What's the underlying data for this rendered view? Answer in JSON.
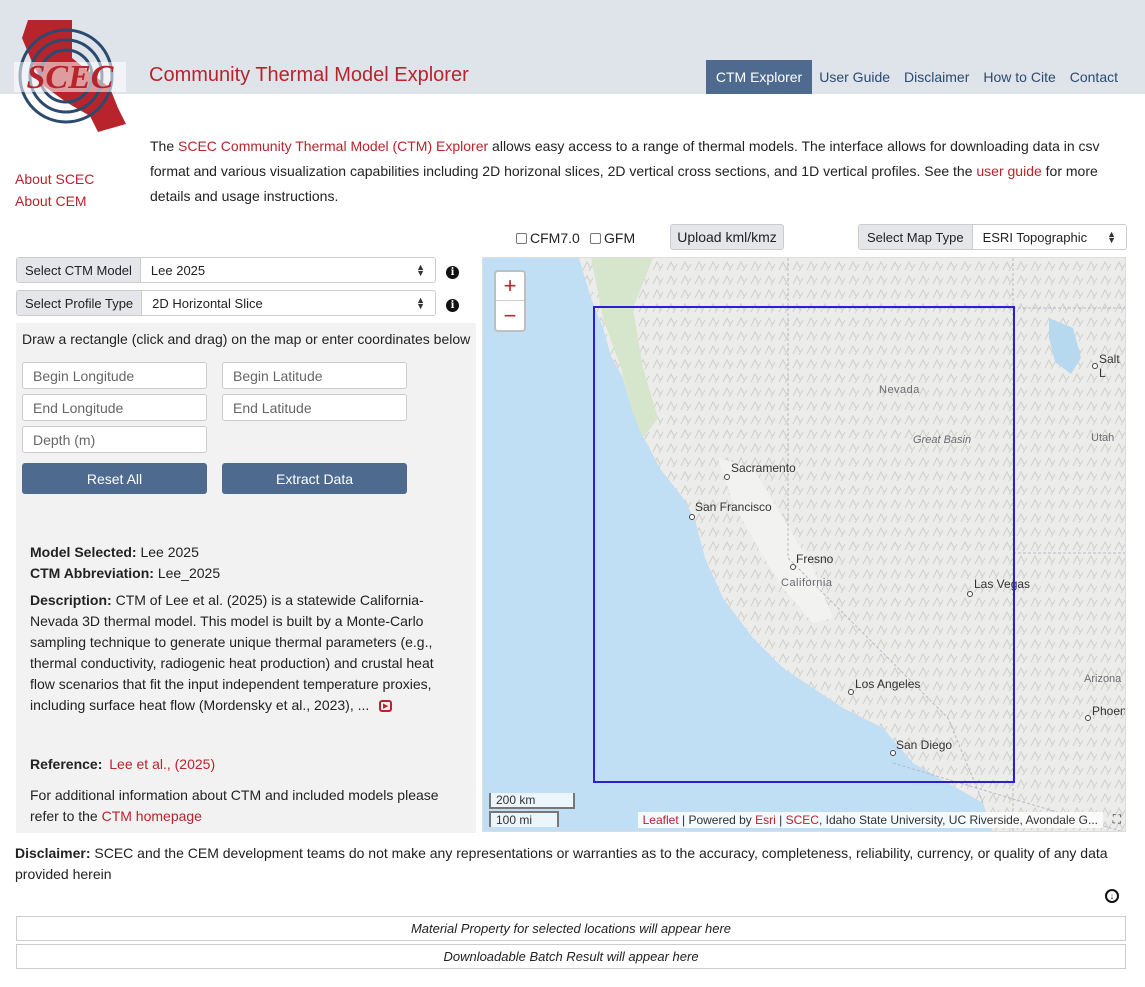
{
  "header": {
    "logo_text": "SCEC",
    "title": "Community Thermal Model Explorer",
    "nav": [
      "CTM Explorer",
      "User Guide",
      "Disclaimer",
      "How to Cite",
      "Contact"
    ]
  },
  "side_links": [
    "About SCEC",
    "About CEM"
  ],
  "intro": {
    "p1": "The ",
    "link1": "SCEC Community Thermal Model (CTM) Explorer",
    "p2": " allows easy access to a range of thermal models. The interface allows for downloading data in csv format and various visualization capabilities including 2D horizonal slices, 2D vertical cross sections, and 1D vertical profiles. See the ",
    "link2": "user guide",
    "p3": " for more details and usage instructions."
  },
  "toolbar": {
    "cfm_label": "CFM7.0",
    "gfm_label": "GFM",
    "upload_label": "Upload kml/kmz",
    "map_type_label": "Select Map Type",
    "map_type_value": "ESRI Topographic"
  },
  "controls": {
    "model_label": "Select CTM Model",
    "model_value": "Lee 2025",
    "profile_label": "Select Profile Type",
    "profile_value": "2D Horizontal Slice",
    "instruction": "Draw a rectangle (click and drag) on the map or enter coordinates below",
    "begin_lon": "Begin Longitude",
    "begin_lat": "Begin Latitude",
    "end_lon": "End Longitude",
    "end_lat": "End Latitude",
    "depth": "Depth (m)",
    "reset_label": "Reset All",
    "extract_label": "Extract Data"
  },
  "model_info": {
    "selected_label": "Model Selected:",
    "selected_value": "Lee 2025",
    "abbr_label": "CTM Abbreviation:",
    "abbr_value": "Lee_2025",
    "desc_label": "Description:",
    "desc_value": "CTM of Lee et al. (2025) is a statewide California-Nevada 3D thermal model. This model is built by a Monte-Carlo sampling technique to generate unique thermal parameters (e.g., thermal conductivity, radiogenic heat production) and crustal heat flow scenarios that fit the input independent temperature proxies, including surface heat flow (Mordensky et al., 2023), ...",
    "ref_label": "Reference:",
    "ref_link": "Lee et al., (2025)",
    "more_text": "For additional information about CTM and included models please refer to the ",
    "more_link": "CTM homepage"
  },
  "map": {
    "labels": {
      "nevada": "Nevada",
      "great_basin": "Great Basin",
      "utah": "Utah",
      "california": "California",
      "arizona": "Arizona",
      "salt": "Salt L",
      "phoenix": "Phoen",
      "sacramento": "Sacramento",
      "sf": "San Francisco",
      "fresno": "Fresno",
      "lasvegas": "Las Vegas",
      "la": "Los Angeles",
      "sd": "San Diego"
    },
    "scale_km": "200 km",
    "scale_mi": "100 mi",
    "attribution": {
      "leaflet": "Leaflet",
      "powered": " | Powered by ",
      "esri": "Esri",
      "sep": " | ",
      "scec": "SCEC",
      "rest": ", Idaho State University, UC Riverside, Avondale G..."
    },
    "selection_color": "#2a1fd8"
  },
  "footer": {
    "disclaimer_label": "Disclaimer:",
    "disclaimer_text": "SCEC and the CEM development teams do not make any representations or warranties as to the accuracy, completeness, reliability, currency, or quality of any data provided herein",
    "material_placeholder": "Material Property for selected locations will appear here",
    "batch_placeholder": "Downloadable Batch Result will appear here"
  }
}
